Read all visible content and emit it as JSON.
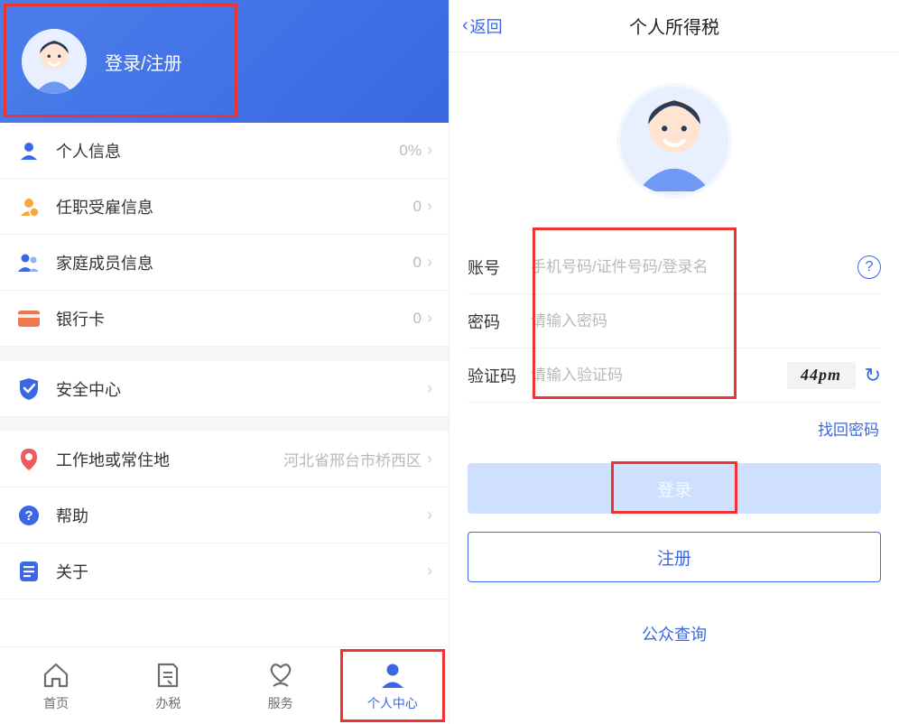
{
  "left": {
    "hero": {
      "login_text": "登录/注册"
    },
    "menu": {
      "personal_info": {
        "label": "个人信息",
        "value": "0%"
      },
      "employment": {
        "label": "任职受雇信息",
        "value": "0"
      },
      "family": {
        "label": "家庭成员信息",
        "value": "0"
      },
      "bank": {
        "label": "银行卡",
        "value": "0"
      },
      "security": {
        "label": "安全中心",
        "value": ""
      },
      "location": {
        "label": "工作地或常住地",
        "value": "河北省邢台市桥西区"
      },
      "help": {
        "label": "帮助",
        "value": ""
      },
      "about": {
        "label": "关于",
        "value": ""
      }
    },
    "tabs": {
      "home": "首页",
      "tax": "办税",
      "service": "服务",
      "me": "个人中心"
    }
  },
  "right": {
    "nav": {
      "back": "返回",
      "title": "个人所得税"
    },
    "form": {
      "account_label": "账号",
      "account_placeholder": "手机号码/证件号码/登录名",
      "password_label": "密码",
      "password_placeholder": "请输入密码",
      "captcha_label": "验证码",
      "captcha_placeholder": "请输入验证码",
      "captcha_value": "44pm"
    },
    "find_password": "找回密码",
    "login_btn": "登录",
    "register_btn": "注册",
    "public_query": "公众查询"
  }
}
